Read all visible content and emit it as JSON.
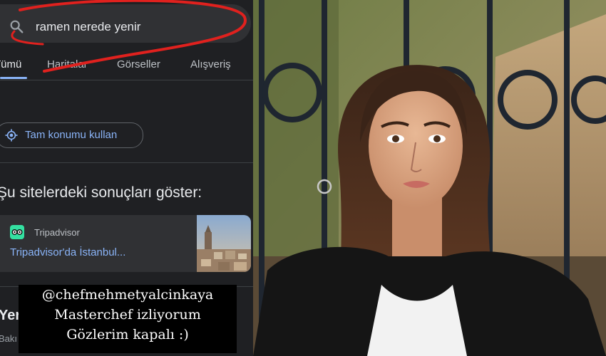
{
  "search": {
    "query": "ramen nerede yenir",
    "icon": "search-icon"
  },
  "tabs": [
    {
      "label": "Tümü",
      "active": true
    },
    {
      "label": "Haritalar",
      "active": false
    },
    {
      "label": "Görseller",
      "active": false
    },
    {
      "label": "Alışveriş",
      "active": false
    }
  ],
  "location": {
    "label": "Tam konumu kullan",
    "icon": "location-target-icon"
  },
  "sites_section": {
    "title": "Şu sitelerdeki sonuçları göster:"
  },
  "result_card": {
    "source": "Tripadvisor",
    "link_text": "Tripadvisor'da İstanbul...",
    "logo_icon": "tripadvisor-owl-icon"
  },
  "next_result": {
    "title_fragment": "Yer",
    "subtitle_fragment": "Bakı"
  },
  "caption": {
    "line1": "@chefmehmetyalcinkaya",
    "line2": "Masterchef izliyorum",
    "line3": "Gözlerim kapalı :)"
  },
  "colors": {
    "background": "#1f2023",
    "surface": "#303134",
    "link": "#8ab4f8",
    "annotation_red": "#e0211e"
  }
}
